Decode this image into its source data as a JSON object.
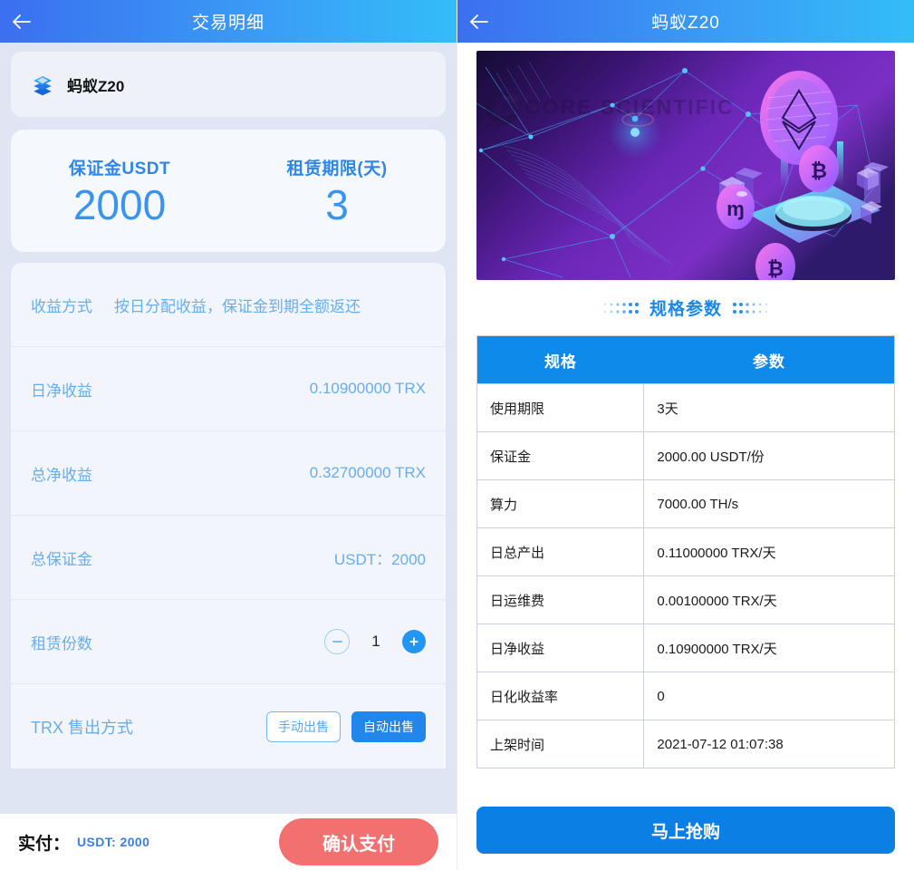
{
  "left": {
    "header": {
      "title": "交易明细",
      "back_icon": "back-arrow-icon"
    },
    "product": {
      "name": "蚂蚁Z20",
      "icon": "stacked-cube-icon"
    },
    "stats": [
      {
        "label": "保证金USDT",
        "value": "2000"
      },
      {
        "label": "租赁期限(天)",
        "value": "3"
      }
    ],
    "rows": [
      {
        "label": "收益方式",
        "value": "按日分配收益，保证金到期全额返还"
      },
      {
        "label": "日净收益",
        "value": "0.10900000 TRX"
      },
      {
        "label": "总净收益",
        "value": "0.32700000 TRX"
      },
      {
        "label": "总保证金",
        "value": "USDT：2000"
      }
    ],
    "quantity_row": {
      "label": "租赁份数",
      "count": "1",
      "minus_icon": "minus-circle-icon",
      "plus_icon": "plus-circle-icon"
    },
    "sell_mode_row": {
      "label": "TRX 售出方式",
      "manual": "手动出售",
      "auto": "自动出售",
      "selected": "自动出售"
    },
    "paybar": {
      "label": "实付：",
      "amount": "USDT: 2000",
      "button": "确认支付"
    }
  },
  "right": {
    "header": {
      "title": "蚂蚁Z20",
      "back_icon": "back-arrow-icon"
    },
    "hero": {
      "watermark": "CORE SCIENTIFIC",
      "alt": "crypto-mining-banner"
    },
    "section_title": "规格参数",
    "table": {
      "columns": [
        "规格",
        "参数"
      ],
      "rows": [
        [
          "使用期限",
          "3天"
        ],
        [
          "保证金",
          "2000.00 USDT/份"
        ],
        [
          "算力",
          "7000.00 TH/s"
        ],
        [
          "日总产出",
          "0.11000000 TRX/天"
        ],
        [
          "日运维费",
          "0.00100000 TRX/天"
        ],
        [
          "日净收益",
          "0.10900000 TRX/天"
        ],
        [
          "日化收益率",
          "0"
        ],
        [
          "上架时间",
          "2021-07-12 01:07:38"
        ]
      ]
    },
    "buy_button": "马上抢购"
  },
  "colors": {
    "header_gradient_start": "#3b6ff0",
    "header_gradient_end": "#33bdf8",
    "accent_blue": "#2287ea",
    "label_blue": "#68adec",
    "pay_coral": "#f2706f",
    "panel_bg": "#dfe5f3",
    "table_header": "#0d8aea"
  }
}
